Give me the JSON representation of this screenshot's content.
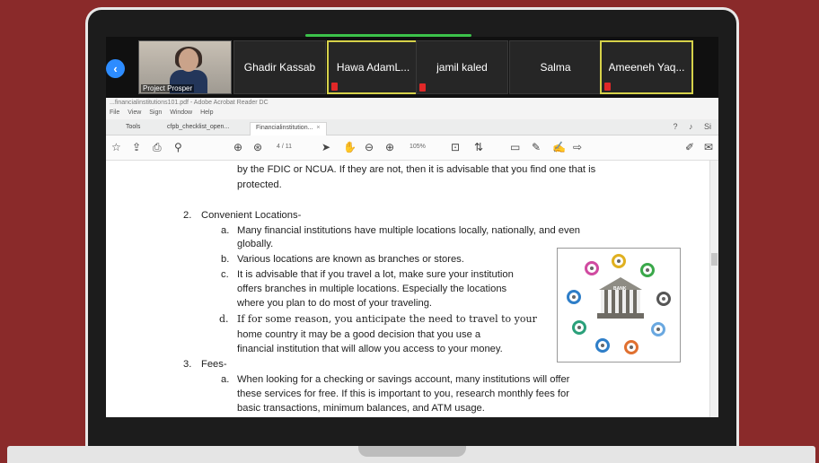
{
  "zoom": {
    "self_name": "Project Prosper",
    "participants": [
      {
        "name": "Ghadir Kassab",
        "muted": false
      },
      {
        "name": "Hawa AdamL...",
        "muted": true
      },
      {
        "name": "jamil kaled",
        "muted": true
      },
      {
        "name": "Salma",
        "muted": false
      },
      {
        "name": "Ameeneh Yaq...",
        "muted": true
      }
    ]
  },
  "acrobat": {
    "window_title": "...financialinstitutions101.pdf - Adobe Acrobat Reader DC",
    "menu": [
      "File",
      "View",
      "Sign",
      "Window",
      "Help"
    ],
    "tabs": [
      {
        "label": "Tools"
      },
      {
        "label": "cfpb_checklist_open..."
      },
      {
        "label": "Financialinstitution..."
      }
    ],
    "page_indicator": "4 / 11",
    "zoom_level": "105%"
  },
  "document": {
    "lines": [
      "by the FDIC or NCUA.  If they are not, then it is advisable that you find one that is",
      "protected.",
      "2.",
      "Convenient Locations-",
      "a.",
      "Many financial institutions have multiple locations locally, nationally, and even",
      "globally.",
      "b.",
      "Various locations are known as branches or stores.",
      "c.",
      "It is advisable that if you travel a lot, make sure your institution",
      "offers branches in multiple locations.  Especially the locations",
      "where you plan to do most of your traveling.",
      "d.",
      "If for some reason, you anticipate the need to travel to your",
      "home country it may be a good decision that you use a",
      "financial institution that will allow you access to your money.",
      "3.",
      "Fees-",
      "a.",
      "When looking for a checking or savings account, many institutions will offer",
      "these services for free.  If this is important to you, research monthly fees for",
      "basic transactions, minimum balances, and ATM usage."
    ],
    "image_label": "BANK"
  },
  "colors": {
    "background": "#8a2a2a",
    "zoom_blue": "#2d8cff",
    "active_speaker": "#d6d24a",
    "muted_red": "#e02828"
  }
}
